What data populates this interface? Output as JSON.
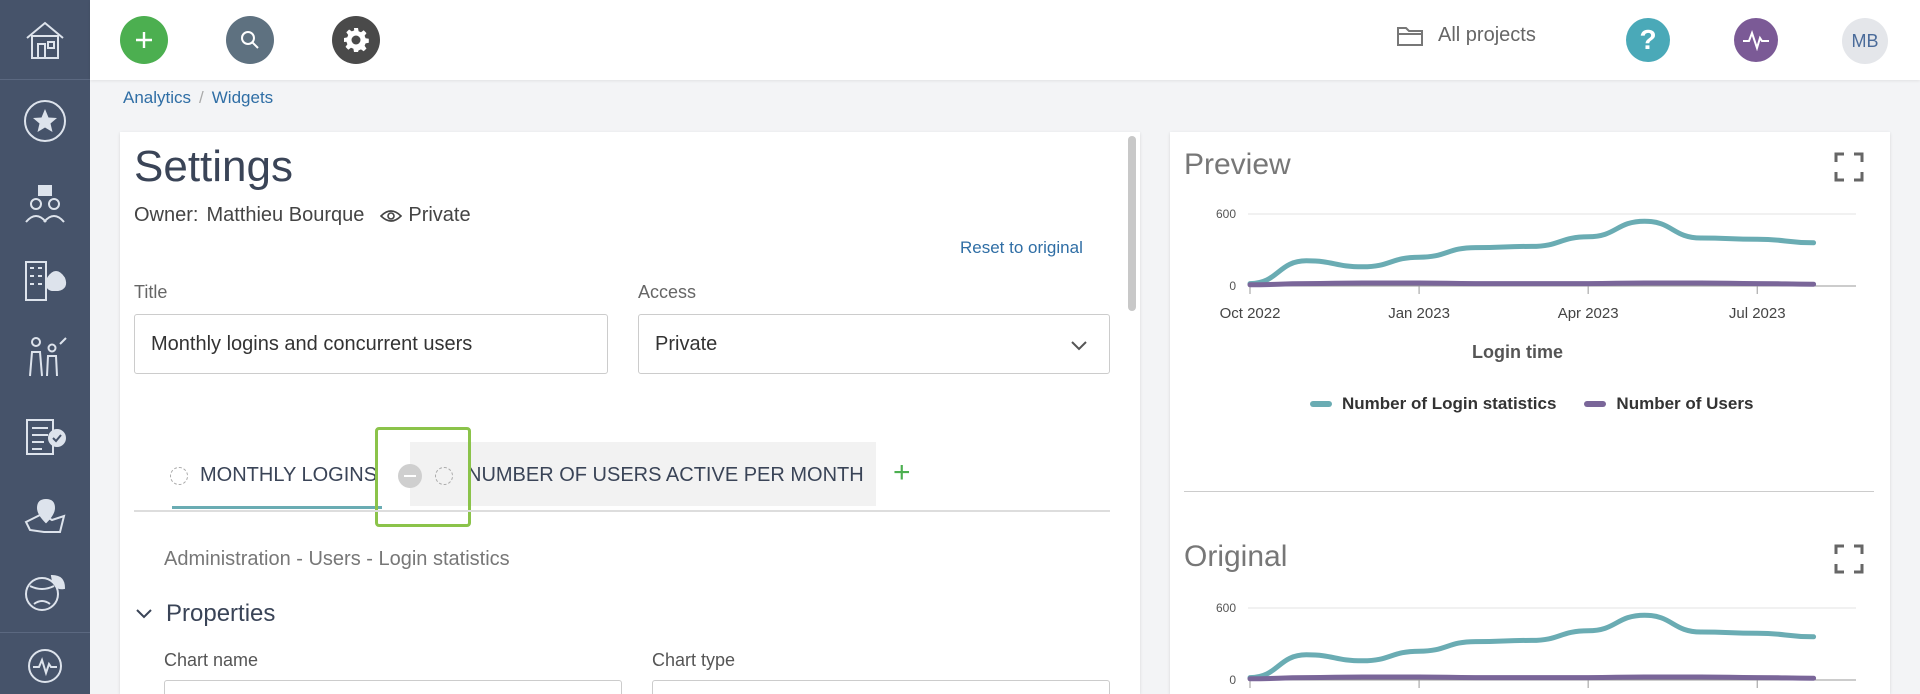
{
  "topbar": {
    "all_projects": "All projects",
    "avatar_initials": "MB"
  },
  "colors": {
    "accent_green": "#4caf50",
    "search_grey": "#5e7180",
    "gear_dark": "#4a4a4a",
    "help_teal": "#4aa9b8",
    "activity_purple": "#7b5a96",
    "series_login": "#6aacb3",
    "series_users": "#7a6699"
  },
  "breadcrumb": {
    "item1": "Analytics",
    "sep": "/",
    "item2": "Widgets"
  },
  "settings": {
    "title": "Settings",
    "owner_label": "Owner:",
    "owner_name": "Matthieu Bourque",
    "visibility": "Private",
    "reset": "Reset to original",
    "title_label": "Title",
    "title_value": "Monthly logins and concurrent users",
    "access_label": "Access",
    "access_value": "Private",
    "tabs": [
      "Monthly logins",
      "Number of users active per month"
    ],
    "source": "Administration - Users - Login statistics",
    "properties": "Properties",
    "chart_name_label": "Chart name",
    "chart_type_label": "Chart type"
  },
  "preview": {
    "title": "Preview"
  },
  "original": {
    "title": "Original"
  },
  "chart_data": [
    {
      "type": "line",
      "xlabel": "Login time",
      "x_ticks": [
        "Oct 2022",
        "Jan 2023",
        "Apr 2023",
        "Jul 2023"
      ],
      "y_ticks": [
        "600",
        "0"
      ],
      "ylim": [
        0,
        600
      ],
      "x": [
        "2022-10",
        "2022-11",
        "2022-12",
        "2023-01",
        "2023-02",
        "2023-03",
        "2023-04",
        "2023-05",
        "2023-06",
        "2023-07",
        "2023-08"
      ],
      "series": [
        {
          "name": "Number of Login statistics",
          "values": [
            20,
            210,
            160,
            240,
            320,
            330,
            410,
            540,
            400,
            390,
            360
          ]
        },
        {
          "name": "Number of Users",
          "values": [
            10,
            20,
            25,
            25,
            20,
            20,
            20,
            25,
            25,
            20,
            15
          ]
        }
      ]
    },
    {
      "type": "line",
      "y_ticks": [
        "600",
        "0"
      ],
      "ylim": [
        0,
        600
      ],
      "x": [
        "2022-10",
        "2022-11",
        "2022-12",
        "2023-01",
        "2023-02",
        "2023-03",
        "2023-04",
        "2023-05",
        "2023-06",
        "2023-07",
        "2023-08"
      ],
      "series": [
        {
          "values": [
            20,
            210,
            160,
            240,
            320,
            330,
            410,
            540,
            400,
            390,
            360
          ]
        },
        {
          "values": [
            10,
            20,
            25,
            25,
            20,
            20,
            20,
            25,
            25,
            20,
            15
          ]
        }
      ]
    }
  ]
}
